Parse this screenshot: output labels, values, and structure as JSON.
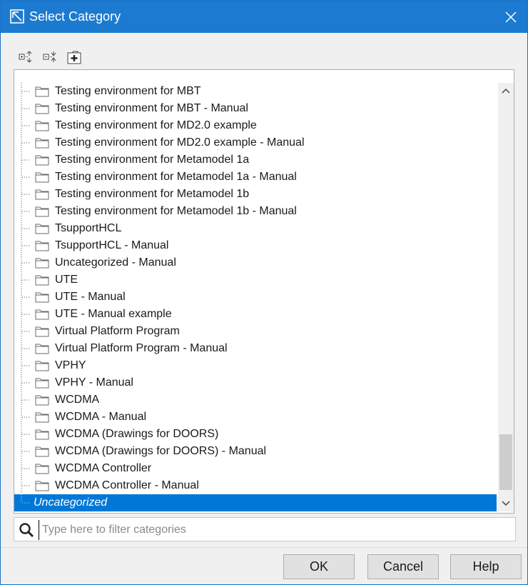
{
  "window": {
    "title": "Select Category"
  },
  "toolbar": {
    "buttons": [
      {
        "icon": "expand-all-icon"
      },
      {
        "icon": "collapse-all-icon"
      },
      {
        "icon": "new-category-icon"
      }
    ]
  },
  "tree": {
    "items": [
      "Testing environment for MBT",
      "Testing environment for MBT - Manual",
      "Testing environment for MD2.0 example",
      "Testing environment for MD2.0 example - Manual",
      "Testing environment for Metamodel 1a",
      "Testing environment for Metamodel 1a - Manual",
      "Testing environment for Metamodel 1b",
      "Testing environment for Metamodel 1b - Manual",
      "TsupportHCL",
      "TsupportHCL - Manual",
      "Uncategorized - Manual",
      "UTE",
      "UTE - Manual",
      "UTE - Manual example",
      "Virtual Platform Program",
      "Virtual Platform Program - Manual",
      "VPHY",
      "VPHY - Manual",
      "WCDMA",
      "WCDMA - Manual",
      "WCDMA (Drawings for DOORS)",
      "WCDMA (Drawings for DOORS) - Manual",
      "WCDMA Controller",
      "WCDMA Controller - Manual"
    ],
    "selected": "Uncategorized"
  },
  "search": {
    "placeholder": "Type here to filter categories",
    "value": ""
  },
  "buttons": {
    "ok": "OK",
    "cancel": "Cancel",
    "help": "Help"
  },
  "colors": {
    "titlebar": "#1c7bd0",
    "selection": "#0078d7"
  }
}
